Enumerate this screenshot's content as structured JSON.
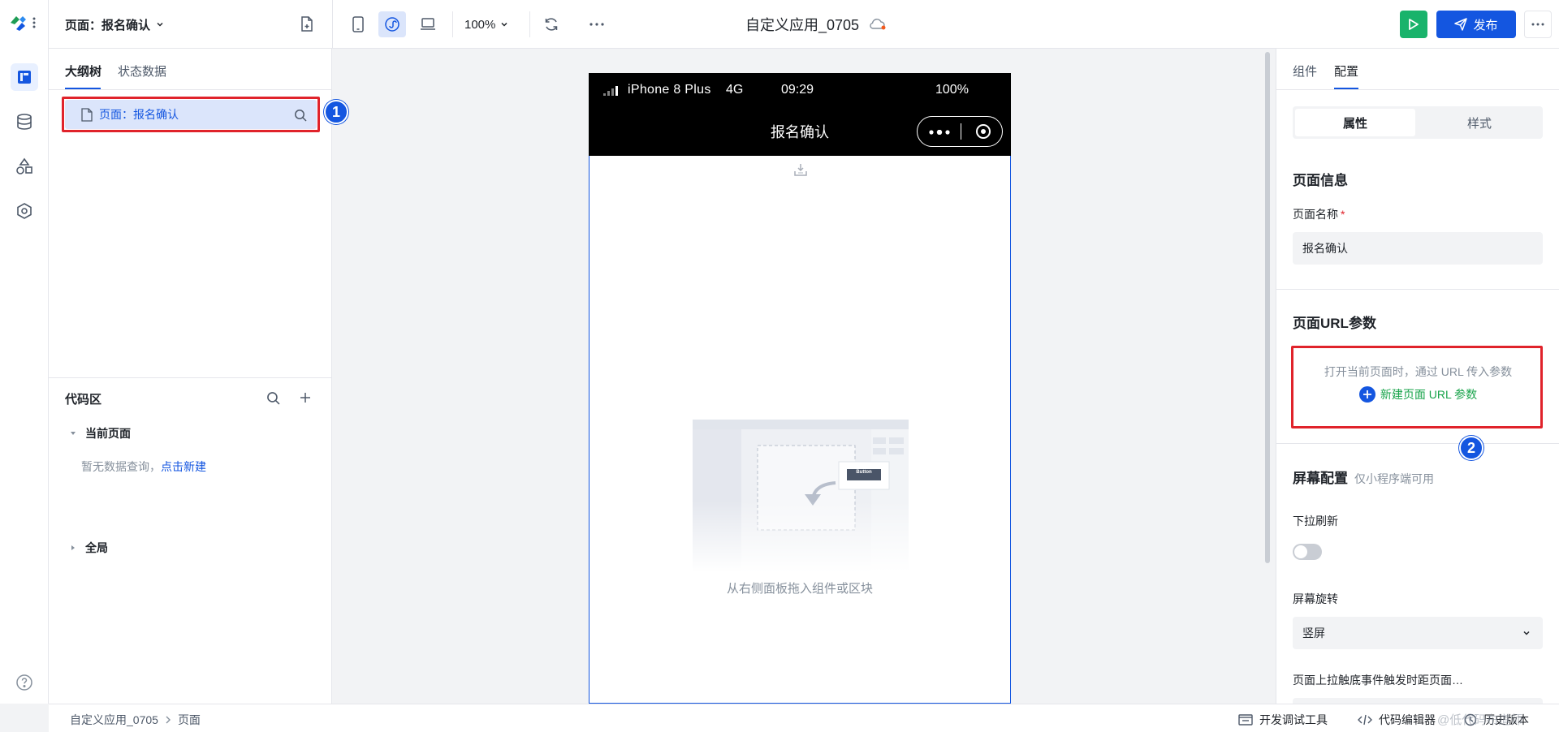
{
  "topbar": {
    "page_selector": "页面：报名确认",
    "zoom": "100%",
    "app_title": "自定义应用_0705",
    "publish_label": "发布"
  },
  "left_panel": {
    "tabs": [
      {
        "label": "大纲树",
        "active": true
      },
      {
        "label": "状态数据",
        "active": false
      }
    ],
    "tree_item": "页面：报名确认",
    "code_area": {
      "title": "代码区",
      "current_page": "当前页面",
      "empty_text": "暂无数据查询，",
      "create_link": "点击新建",
      "global": "全局"
    }
  },
  "phone": {
    "device": "iPhone 8 Plus",
    "network": "4G",
    "time": "09:29",
    "battery": "100%",
    "nav_title": "报名确认",
    "empty_hint": "从右侧面板拖入组件或区块",
    "illustration_button": "Button"
  },
  "right_panel": {
    "tabs": [
      {
        "label": "组件",
        "active": false
      },
      {
        "label": "配置",
        "active": true
      }
    ],
    "segment": [
      "属性",
      "样式"
    ],
    "page_info_title": "页面信息",
    "page_name_label": "页面名称",
    "required_mark": "*",
    "page_name_value": "报名确认",
    "url_params_title": "页面URL参数",
    "url_params_desc": "打开当前页面时，通过 URL 传入参数",
    "new_url_param": "新建页面 URL 参数",
    "screen_config_title": "屏幕配置",
    "screen_config_note": "仅小程序端可用",
    "pull_refresh_label": "下拉刷新",
    "pull_refresh_on": false,
    "rotate_label": "屏幕旋转",
    "rotate_value": "竖屏",
    "reach_bottom_label": "页面上拉触底事件触发时距页面…"
  },
  "markers": [
    "1",
    "2"
  ],
  "statusbar": {
    "breadcrumb": [
      "自定义应用_0705",
      "页面"
    ],
    "dev_tools": "开发调试工具",
    "code_editor": "代码编辑器",
    "history": "历史版本",
    "watermark": "@低代码布道师"
  },
  "colors": {
    "accent": "#1456e0",
    "run_green": "#19b36b",
    "annotation_red": "#e0232b",
    "link_green": "#17a34a"
  }
}
